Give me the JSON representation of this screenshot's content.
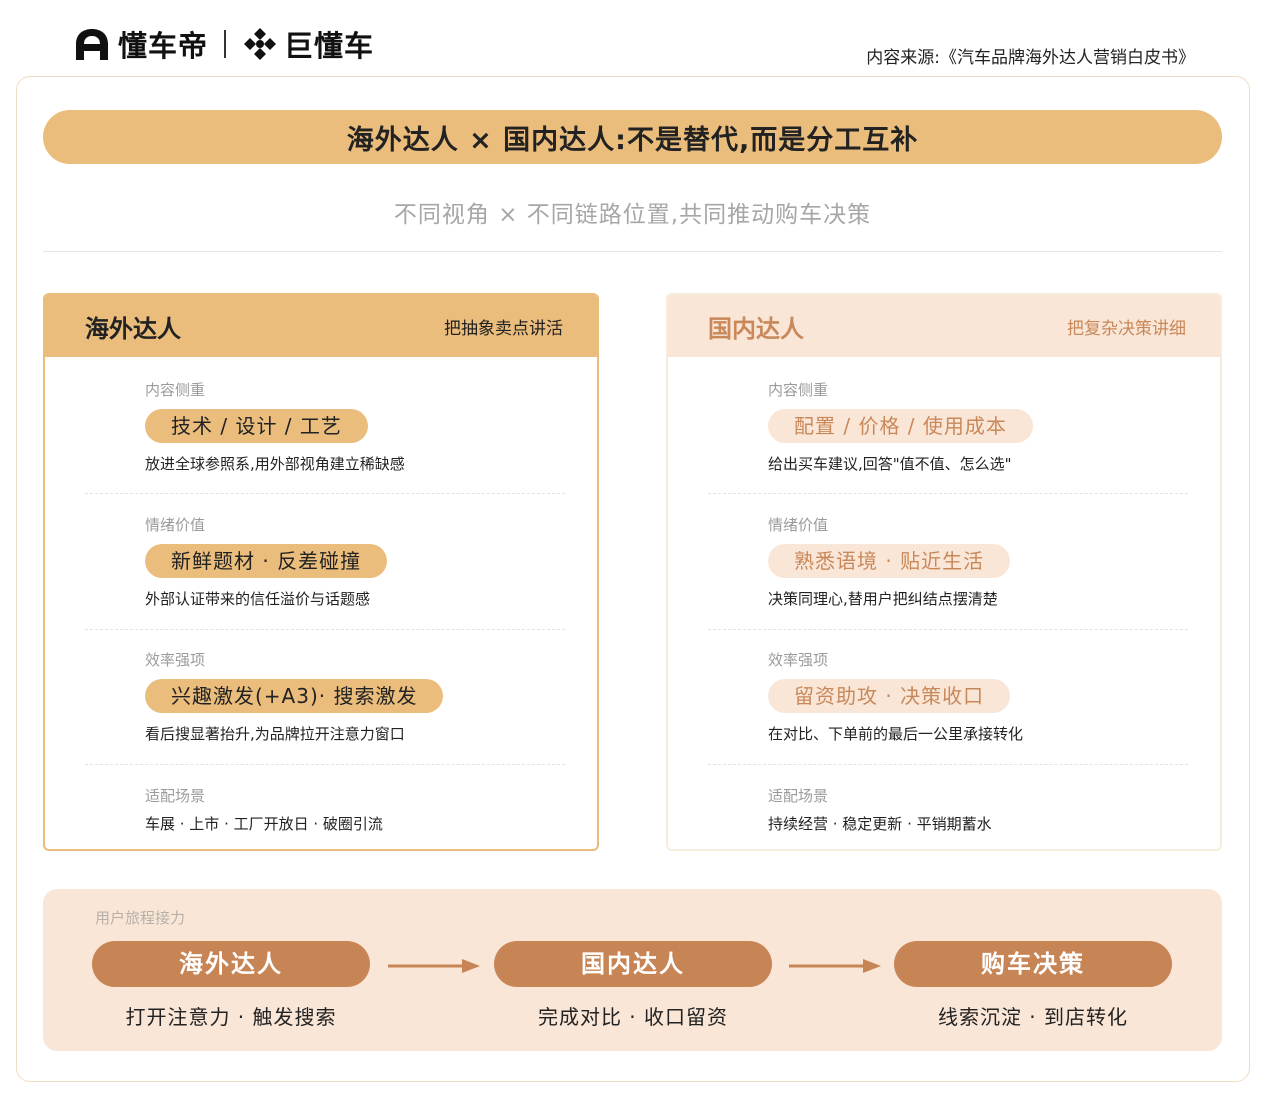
{
  "header": {
    "brand1": "懂车帝",
    "brand2": "巨懂车",
    "source": "内容来源:《汽车品牌海外达人营销白皮书》"
  },
  "title": "海外达人 × 国内达人:不是替代,而是分工互补",
  "subtitle": "不同视角 × 不同链路位置,共同推动购车决策",
  "cards": [
    {
      "title": "海外达人",
      "tag": "把抽象卖点讲活",
      "sections": [
        {
          "label": "内容侧重",
          "pill": "技术 / 设计 / 工艺",
          "desc": "放进全球参照系,用外部视角建立稀缺感"
        },
        {
          "label": "情绪价值",
          "pill": "新鲜题材 · 反差碰撞",
          "desc": "外部认证带来的信任溢价与话题感"
        },
        {
          "label": "效率强项",
          "pill": "兴趣激发(+A3)· 搜索激发",
          "desc": "看后搜显著抬升,为品牌拉开注意力窗口"
        },
        {
          "label": "适配场景",
          "desc": "车展 · 上市 · 工厂开放日 · 破圈引流"
        }
      ]
    },
    {
      "title": "国内达人",
      "tag": "把复杂决策讲细",
      "sections": [
        {
          "label": "内容侧重",
          "pill": "配置 / 价格 / 使用成本",
          "desc": "给出买车建议,回答\"值不值、怎么选\""
        },
        {
          "label": "情绪价值",
          "pill": "熟悉语境 · 贴近生活",
          "desc": "决策同理心,替用户把纠结点摆清楚"
        },
        {
          "label": "效率强项",
          "pill": "留资助攻 · 决策收口",
          "desc": "在对比、下单前的最后一公里承接转化"
        },
        {
          "label": "适配场景",
          "desc": "持续经营 · 稳定更新 · 平销期蓄水"
        }
      ]
    }
  ],
  "journey": {
    "label": "用户旅程接力",
    "steps": [
      {
        "title": "海外达人",
        "desc": "打开注意力 · 触发搜索"
      },
      {
        "title": "国内达人",
        "desc": "完成对比 · 收口留资"
      },
      {
        "title": "购车决策",
        "desc": "线索沉淀 · 到店转化"
      }
    ]
  },
  "colors": {
    "accent": "#ebbd7c",
    "soft": "#f9e6d7",
    "step": "#c78455",
    "softText": "#c9885a"
  }
}
